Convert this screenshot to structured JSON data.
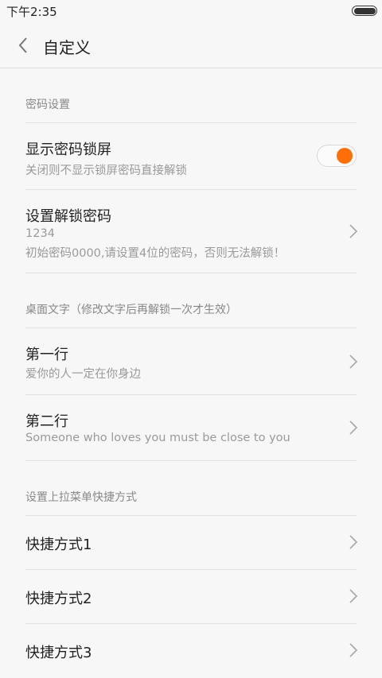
{
  "status": {
    "time": "下午2:35"
  },
  "appbar": {
    "title": "自定义"
  },
  "sections": {
    "password": {
      "header": "密码设置",
      "show_lock": {
        "title": "显示密码锁屏",
        "subtitle": "关闭则不显示锁屏密码直接解锁",
        "enabled": true
      },
      "set_password": {
        "title": "设置解锁密码",
        "value": "1234",
        "hint": "初始密码0000,请设置4位的密码，否则无法解锁！"
      }
    },
    "desktop_text": {
      "header": "桌面文字（修改文字后再解锁一次才生效）",
      "line1": {
        "title": "第一行",
        "value": "爱你的人一定在你身边"
      },
      "line2": {
        "title": "第二行",
        "value": "Someone who loves you must be close to you"
      }
    },
    "shortcuts": {
      "header": "设置上拉菜单快捷方式",
      "items": [
        {
          "title": "快捷方式1"
        },
        {
          "title": "快捷方式2"
        },
        {
          "title": "快捷方式3"
        }
      ]
    }
  },
  "colors": {
    "accent": "#ff6f08"
  },
  "icons": {
    "back": "chevron-left-icon",
    "row": "chevron-right-icon",
    "battery": "battery-icon"
  }
}
